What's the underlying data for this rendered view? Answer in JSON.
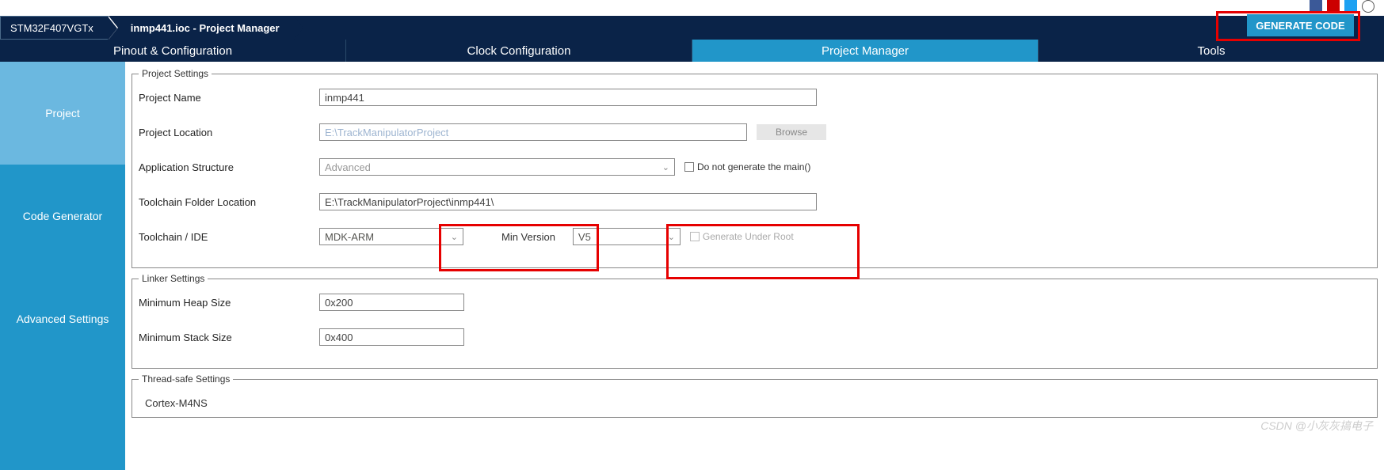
{
  "breadcrumb": {
    "device": "STM32F407VGTx",
    "file": "inmp441.ioc - Project Manager"
  },
  "generate_button": "GENERATE CODE",
  "tabs": {
    "pinout": "Pinout & Configuration",
    "clock": "Clock Configuration",
    "project": "Project Manager",
    "tools": "Tools"
  },
  "sidebar": {
    "project": "Project",
    "codegen": "Code Generator",
    "advanced": "Advanced Settings"
  },
  "project_settings": {
    "legend": "Project Settings",
    "name_label": "Project Name",
    "name_value": "inmp441",
    "location_label": "Project Location",
    "location_value": "E:\\TrackManipulatorProject",
    "browse": "Browse",
    "structure_label": "Application Structure",
    "structure_value": "Advanced",
    "no_main_label": "Do not generate the main()",
    "folder_label": "Toolchain Folder Location",
    "folder_value": "E:\\TrackManipulatorProject\\inmp441\\",
    "toolchain_label": "Toolchain / IDE",
    "toolchain_value": "MDK-ARM",
    "minver_label": "Min Version",
    "minver_value": "V5",
    "gen_root_label": "Generate Under Root"
  },
  "linker_settings": {
    "legend": "Linker Settings",
    "heap_label": "Minimum Heap Size",
    "heap_value": "0x200",
    "stack_label": "Minimum Stack Size",
    "stack_value": "0x400"
  },
  "thread_safe": {
    "legend": "Thread-safe Settings",
    "core": "Cortex-M4NS"
  },
  "watermark": "CSDN @小灰灰搞电子"
}
